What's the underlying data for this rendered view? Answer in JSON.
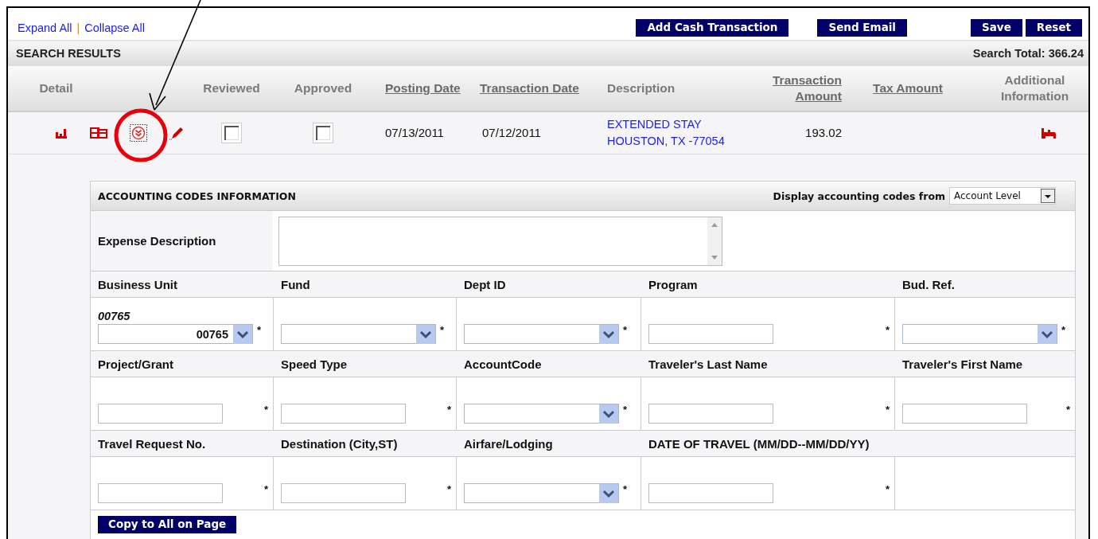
{
  "toolbar": {
    "links": [
      "Expand All",
      "Collapse All"
    ],
    "separator": "|",
    "buttons": [
      "Add Cash Transaction",
      "Send Email",
      "Save",
      "Reset"
    ]
  },
  "results_bar": {
    "title": "SEARCH RESULTS",
    "total": "Search Total: 366.24"
  },
  "table": {
    "columns": [
      {
        "label": "Detail",
        "sortable": false
      },
      {
        "label": "Reviewed",
        "sortable": false
      },
      {
        "label": "Approved",
        "sortable": false
      },
      {
        "label": "Posting Date",
        "sortable": true
      },
      {
        "label": "Transaction Date",
        "sortable": true
      },
      {
        "label": "Description",
        "sortable": false
      },
      {
        "label": "Transaction Amount",
        "sortable": true
      },
      {
        "label": "Tax Amount",
        "sortable": true
      },
      {
        "label": "Additional Information",
        "sortable": false
      }
    ],
    "rows": [
      {
        "reviewed": false,
        "approved": false,
        "posting_date": "07/13/2011",
        "transaction_date": "07/12/2011",
        "description": [
          "EXTENDED STAY",
          "HOUSTON, TX -77054"
        ],
        "amount": "193.02"
      }
    ]
  },
  "accounting": {
    "title": "ACCOUNTING CODES INFORMATION",
    "source_label": "Display accounting codes from",
    "source_value": "Account Level",
    "expense_label": "Expense Description",
    "rows": [
      [
        {
          "label": "Business Unit",
          "kind": "select",
          "note": "00765",
          "value": "00765"
        },
        {
          "label": "Fund",
          "kind": "select"
        },
        {
          "label": "Dept ID",
          "kind": "select"
        },
        {
          "label": "Program",
          "kind": "text"
        },
        {
          "label": "Bud. Ref.",
          "kind": "select"
        }
      ],
      [
        {
          "label": "Project/Grant",
          "kind": "text"
        },
        {
          "label": "Speed Type",
          "kind": "text"
        },
        {
          "label": "AccountCode",
          "kind": "select"
        },
        {
          "label": "Traveler's Last Name",
          "kind": "text"
        },
        {
          "label": "Traveler's First Name",
          "kind": "text"
        }
      ],
      [
        {
          "label": "Travel Request No.",
          "kind": "text"
        },
        {
          "label": "Destination (City,ST)",
          "kind": "text"
        },
        {
          "label": "Airfare/Lodging",
          "kind": "select"
        },
        {
          "label": "DATE OF TRAVEL (MM/DD--MM/DD/YY)",
          "kind": "text"
        }
      ]
    ],
    "required_mark": "*",
    "copy_button": "Copy to All on Page"
  }
}
